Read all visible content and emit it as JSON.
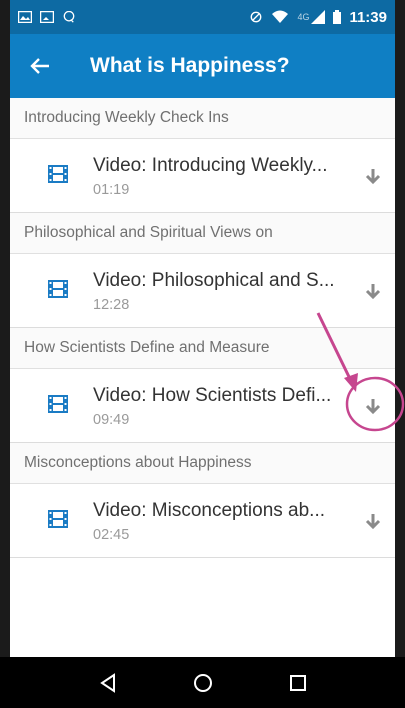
{
  "status_bar": {
    "time": "11:39",
    "network": "4G",
    "icons": [
      "image-icon",
      "gallery-icon",
      "chat-icon",
      "do-not-disturb-icon",
      "wifi-icon",
      "signal-icon",
      "battery-icon"
    ]
  },
  "app_bar": {
    "back_icon": "arrow-left-icon",
    "title": "What is Happiness?"
  },
  "sections": [
    {
      "header": "Introducing Weekly Check Ins",
      "item": {
        "icon": "film-icon",
        "title": "Video: Introducing Weekly...",
        "duration": "01:19",
        "action_icon": "download-icon"
      }
    },
    {
      "header": "Philosophical and Spiritual Views on",
      "item": {
        "icon": "film-icon",
        "title": "Video: Philosophical and S...",
        "duration": "12:28",
        "action_icon": "download-icon"
      }
    },
    {
      "header": "How Scientists Define and Measure",
      "item": {
        "icon": "film-icon",
        "title": "Video: How Scientists Defi...",
        "duration": "09:49",
        "action_icon": "download-icon"
      }
    },
    {
      "header": "Misconceptions about Happiness",
      "item": {
        "icon": "film-icon",
        "title": "Video: Misconceptions ab...",
        "duration": "02:45",
        "action_icon": "download-icon"
      }
    }
  ],
  "nav_bar": {
    "icons": [
      "nav-back-icon",
      "nav-home-icon",
      "nav-recents-icon"
    ]
  },
  "colors": {
    "status_bar": "#0d6aa3",
    "app_bar": "#0f7fc4",
    "film_icon": "#1a7bc4",
    "annotation": "#c6468f"
  }
}
